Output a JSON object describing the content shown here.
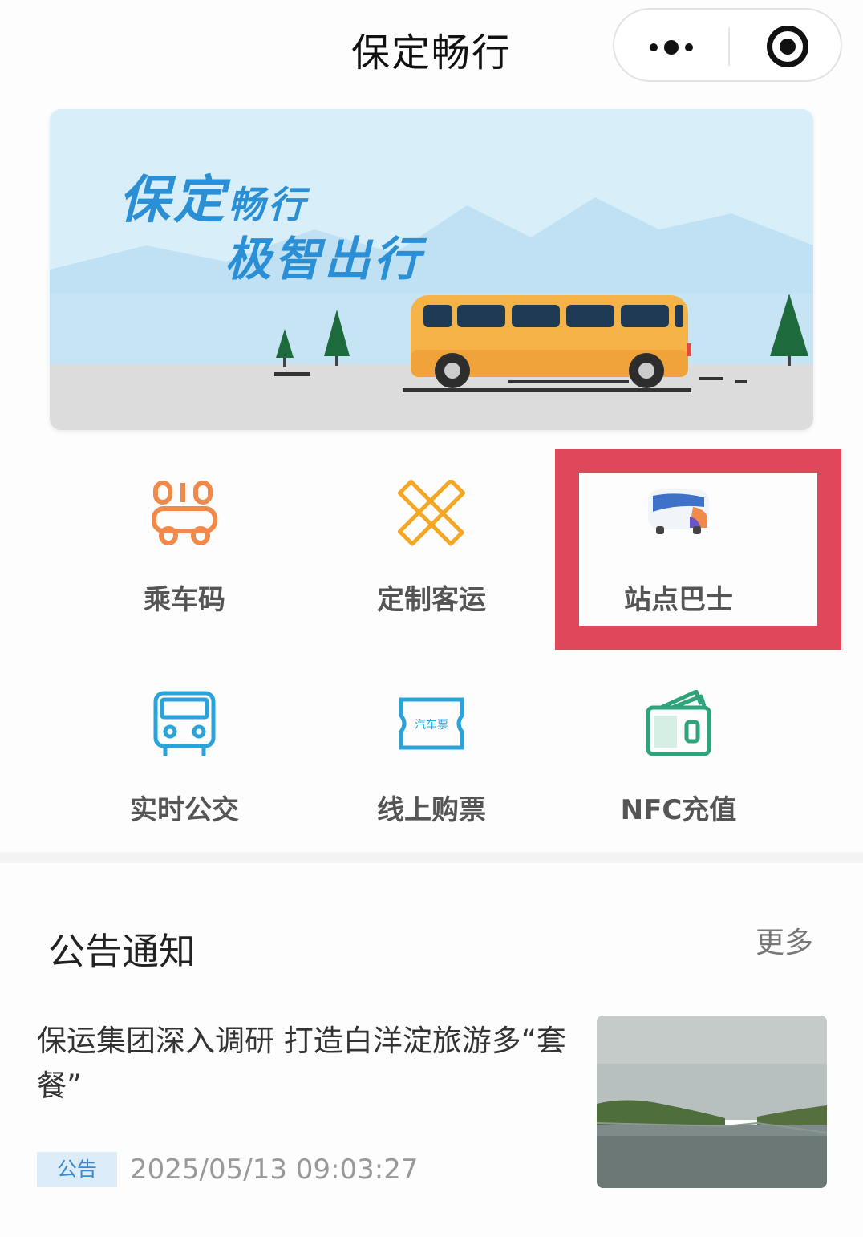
{
  "header": {
    "title": "保定畅行"
  },
  "banner": {
    "line1_big": "保定",
    "line1_small": "畅行",
    "line2": "极智出行"
  },
  "grid": [
    {
      "label": "乘车码",
      "icon": "ride-code-icon"
    },
    {
      "label": "定制客运",
      "icon": "custom-transport-icon"
    },
    {
      "label": "站点巴士",
      "icon": "station-bus-icon"
    },
    {
      "label": "实时公交",
      "icon": "realtime-bus-icon"
    },
    {
      "label": "线上购票",
      "icon": "ticket-icon",
      "icon_text": "汽车票"
    },
    {
      "label": "NFC充值",
      "icon": "wallet-icon"
    }
  ],
  "announcements": {
    "title": "公告通知",
    "more": "更多",
    "items": [
      {
        "title": "保运集团深入调研 打造白洋淀旅游多“套餐”",
        "tag": "公告",
        "time": "2025/05/13 09:03:27"
      }
    ]
  },
  "colors": {
    "highlight": "#e0475b",
    "brand_blue": "#2b8fd6",
    "orange": "#f08a4b",
    "bus_yellow": "#f5b347"
  }
}
